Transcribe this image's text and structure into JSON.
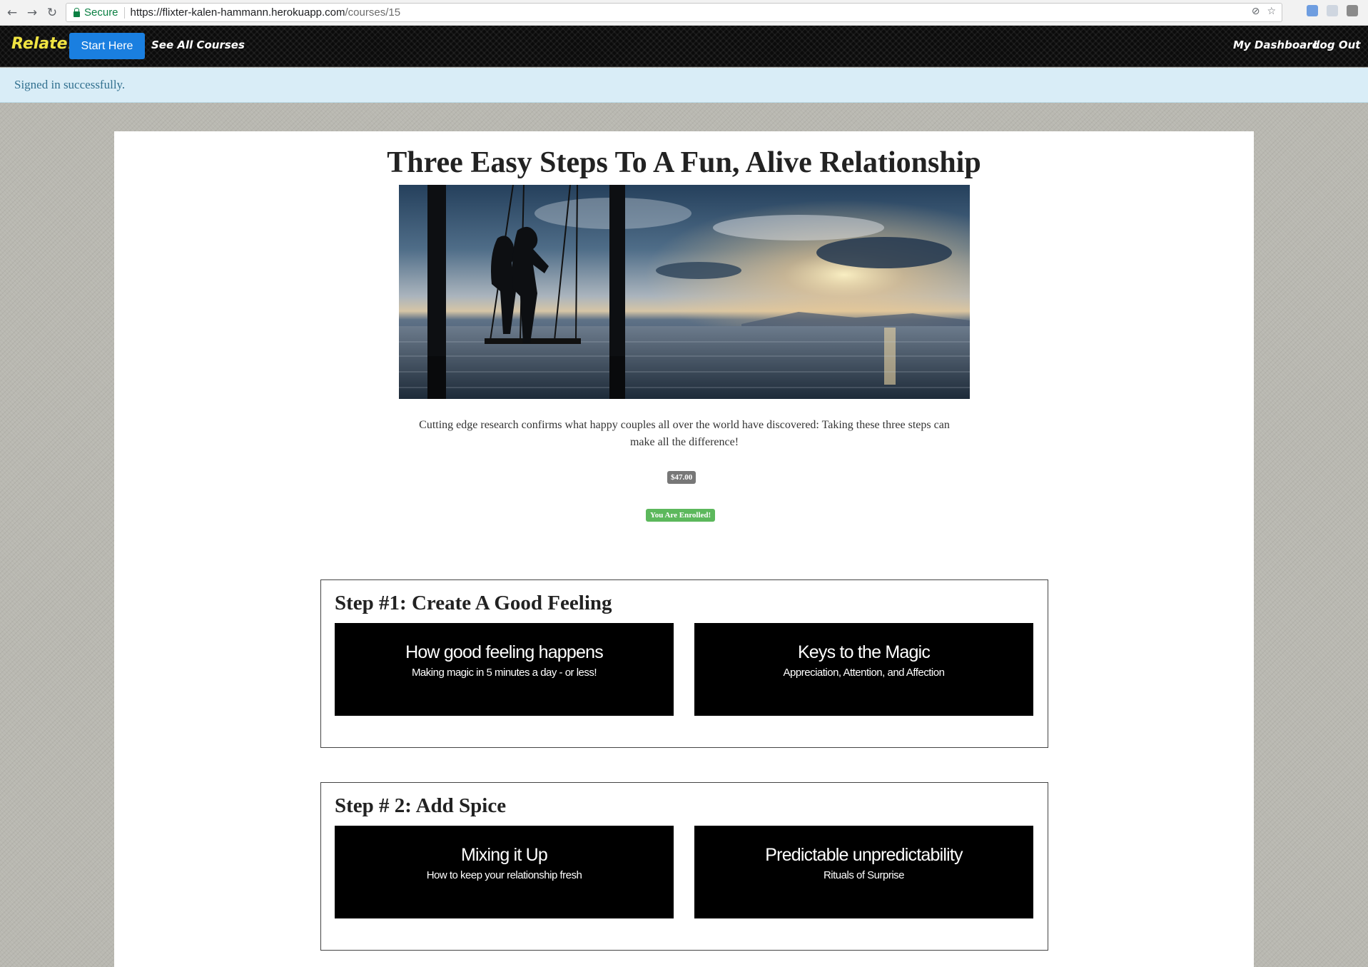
{
  "browser": {
    "secure_label": "Secure",
    "url_host": "https://flixter-kalen-hammann.herokuapp.com",
    "url_path": "/courses/15"
  },
  "navbar": {
    "brand": "Relate!",
    "start_button": "Start Here",
    "see_all_courses": "See All Courses",
    "my_dashboard": "My Dashboard",
    "log_out": "Log Out"
  },
  "flash": {
    "message": "Signed in successfully."
  },
  "course": {
    "title": "Three Easy Steps To A Fun, Alive Relationship",
    "description": "Cutting edge research confirms what happy couples all over the world have discovered: Taking these three steps can make all the difference!",
    "price": "$47.00",
    "enrolled_badge": "You Are Enrolled!",
    "sections": [
      {
        "title": "Step #1: Create A Good Feeling",
        "lessons": [
          {
            "title": "How good feeling happens",
            "subtitle": "Making magic in 5 minutes a day - or less!"
          },
          {
            "title": "Keys to the Magic",
            "subtitle": "Appreciation, Attention, and Affection"
          }
        ]
      },
      {
        "title": "Step # 2: Add Spice",
        "lessons": [
          {
            "title": "Mixing it Up",
            "subtitle": "How to keep your relationship fresh"
          },
          {
            "title": "Predictable unpredictability",
            "subtitle": "Rituals of Surprise"
          }
        ]
      }
    ]
  },
  "colors": {
    "brand_yellow": "#f0e442",
    "primary_button": "#1a7fe0",
    "flash_background": "#d9edf7",
    "enrolled_green": "#5cb85c",
    "price_gray": "#777777"
  }
}
